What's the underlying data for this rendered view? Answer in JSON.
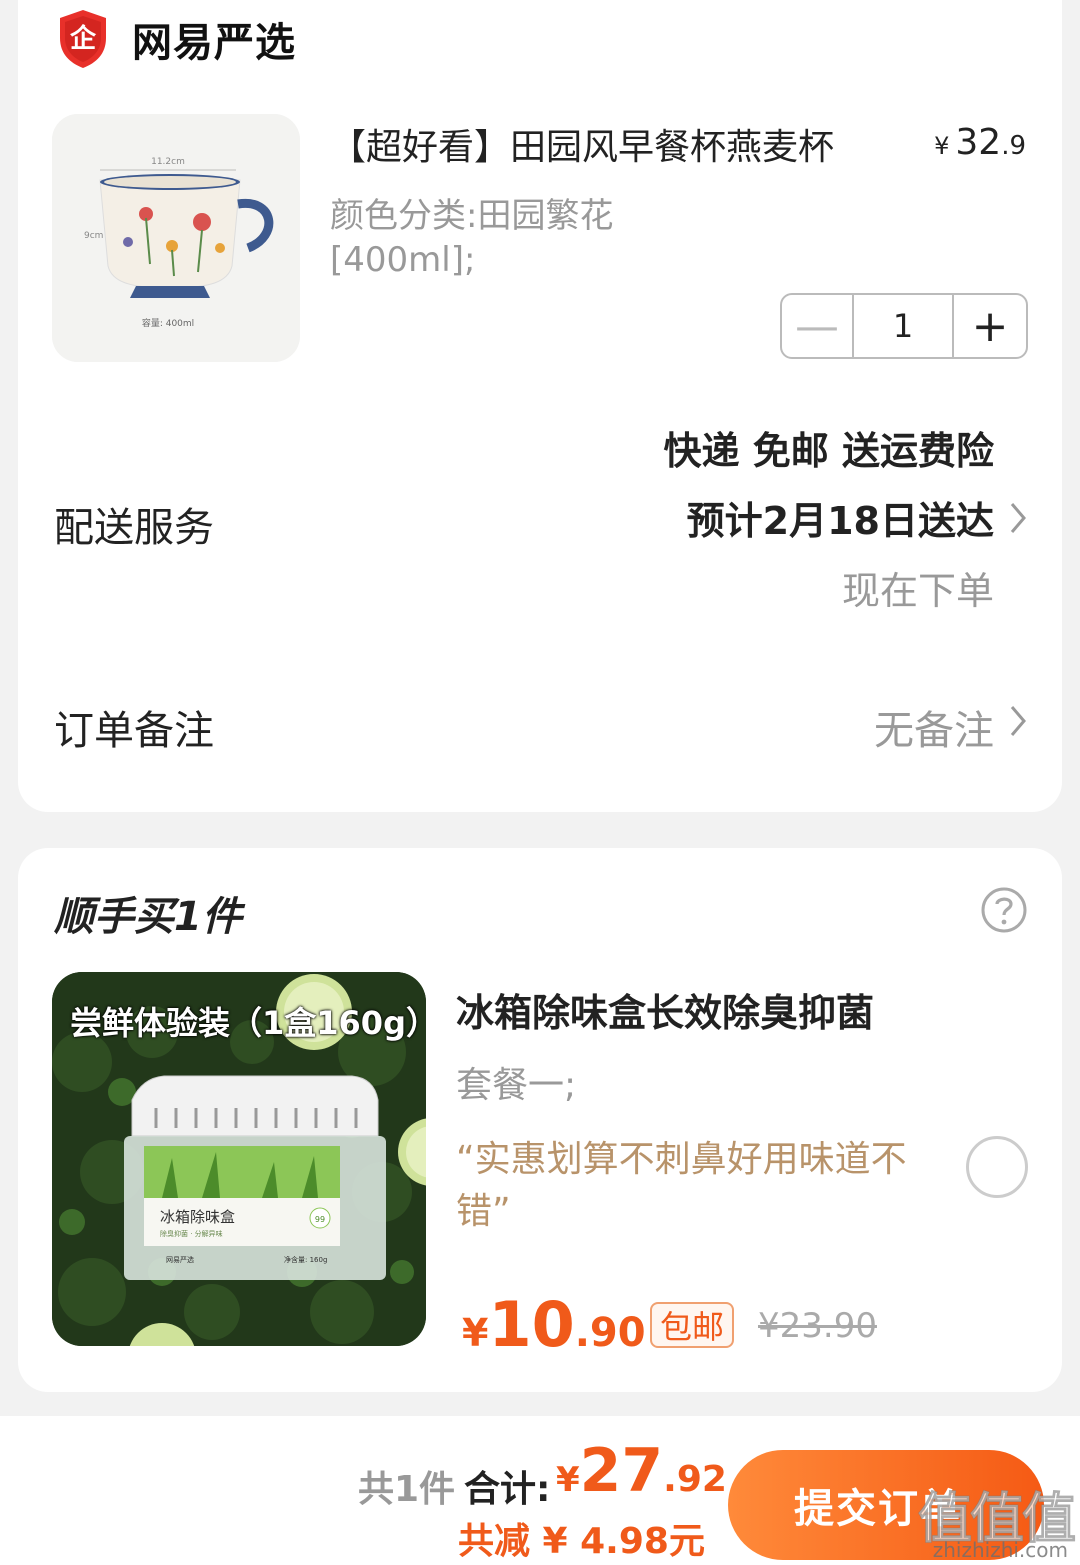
{
  "store": {
    "badge_char": "企",
    "name": "网易严选"
  },
  "product1": {
    "title": "【超好看】田园风早餐杯燕麦杯",
    "price_symbol": "¥",
    "price_int": "32",
    "price_dec": ".9",
    "spec_line1": "颜色分类:田园繁花",
    "spec_line2": "[400ml];",
    "thumb_dim_width": "11.2cm",
    "thumb_dim_height": "9cm",
    "thumb_capacity": "容量: 400ml",
    "quantity": "1",
    "minus": "—",
    "plus": "+"
  },
  "delivery": {
    "label": "配送服务",
    "line1": "快递 免邮 送运费险",
    "line2": "预计2月18日送达",
    "line3": "现在下单"
  },
  "note": {
    "label": "订单备注",
    "value": "无备注"
  },
  "addon": {
    "section_title": "顺手买1件",
    "thumb_tag": "尝鲜体验装（1盒160g）",
    "thumb_box_label": "冰箱除味盒",
    "thumb_box_sub": "除臭抑菌 · 分解异味",
    "thumb_box_brand": "网易严选",
    "thumb_box_weight": "净含量: 160g",
    "thumb_box_badge": "99",
    "title": "冰箱除味盒长效除臭抑菌",
    "spec": "套餐一;",
    "quote": "“实惠划算不刺鼻好用味道不错”",
    "price_symbol": "¥",
    "price_int": "10",
    "price_dec": ".90",
    "free_shipping": "包邮",
    "original_price": "¥23.90"
  },
  "summary": {
    "count": "共1件",
    "total_label": "合计:",
    "total_symbol": "¥",
    "total_int": "27",
    "total_dec": ".92",
    "savings": "共减 ¥ 4.98元",
    "submit": "提交订单"
  },
  "watermark": {
    "main": "值值值",
    "sub": "zhizhizhi.com"
  },
  "colors": {
    "accent": "#f05a1a",
    "quote": "#b8936a",
    "muted": "#999999",
    "badge_red": "#e8302a"
  }
}
